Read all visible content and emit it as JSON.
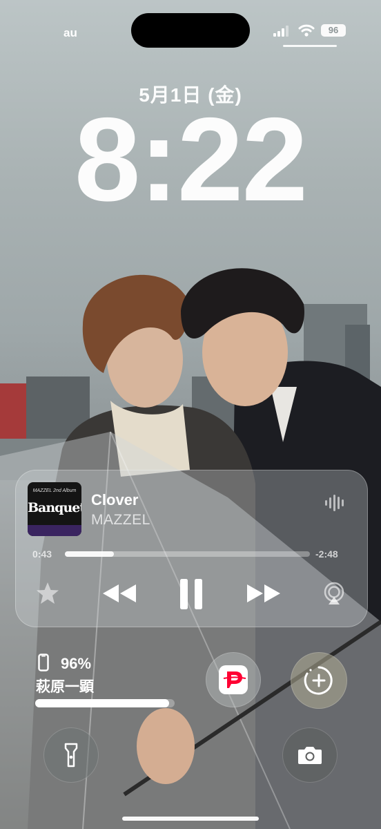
{
  "status_bar": {
    "carrier": "au",
    "battery": "96"
  },
  "lock_screen": {
    "date": "5月1日 (金)",
    "time": "8:22"
  },
  "now_playing": {
    "album_art": {
      "title_text": "Banquet",
      "small_text": "MAZZEL 2nd Album"
    },
    "song": "Clover",
    "artist": "MAZZEL",
    "elapsed": "0:43",
    "remaining": "-2:48",
    "progress": 0.2
  },
  "battery_widget": {
    "percent": "96%",
    "device_name": "萩原一顕",
    "level": 0.96
  },
  "icons": {
    "signal": "cellular-signal-icon",
    "wifi": "wifi-icon",
    "audio": "waveform-icon",
    "favorite": "star-icon",
    "rewind": "rewind-icon",
    "pause": "pause-icon",
    "forward": "fast-forward-icon",
    "airplay": "airplay-icon",
    "paypay": "paypay-icon",
    "widget_add": "add-widget-icon",
    "flashlight": "flashlight-icon",
    "camera": "camera-icon",
    "device": "phone-battery-icon"
  },
  "colors": {
    "paypay_red": "#ff0033"
  }
}
